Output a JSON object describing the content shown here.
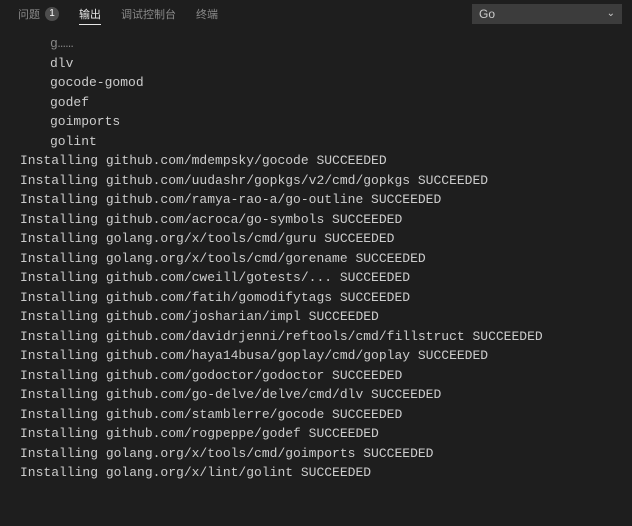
{
  "tabs": {
    "problems": {
      "label": "问题",
      "count": "1"
    },
    "output": {
      "label": "输出"
    },
    "debug": {
      "label": "调试控制台"
    },
    "terminal": {
      "label": "终端"
    }
  },
  "task_select": {
    "value": "Go"
  },
  "pending_obscured": "g……",
  "pending": [
    "dlv",
    "gocode-gomod",
    "godef",
    "goimports",
    "golint"
  ],
  "installs": [
    {
      "prefix": "Installing ",
      "pkg": "github.com/mdempsky/gocode",
      "status": " SUCCEEDED"
    },
    {
      "prefix": "Installing ",
      "pkg": "github.com/uudashr/gopkgs/v2/cmd/gopkgs",
      "status": " SUCCEEDED"
    },
    {
      "prefix": "Installing ",
      "pkg": "github.com/ramya-rao-a/go-outline",
      "status": " SUCCEEDED"
    },
    {
      "prefix": "Installing ",
      "pkg": "github.com/acroca/go-symbols",
      "status": " SUCCEEDED"
    },
    {
      "prefix": "Installing ",
      "pkg": "golang.org/x/tools/cmd/guru",
      "status": " SUCCEEDED"
    },
    {
      "prefix": "Installing ",
      "pkg": "golang.org/x/tools/cmd/gorename",
      "status": " SUCCEEDED"
    },
    {
      "prefix": "Installing ",
      "pkg": "github.com/cweill/gotests/...",
      "status": " SUCCEEDED"
    },
    {
      "prefix": "Installing ",
      "pkg": "github.com/fatih/gomodifytags",
      "status": " SUCCEEDED"
    },
    {
      "prefix": "Installing ",
      "pkg": "github.com/josharian/impl",
      "status": " SUCCEEDED"
    },
    {
      "prefix": "Installing ",
      "pkg": "github.com/davidrjenni/reftools/cmd/fillstruct",
      "status": " SUCCEEDED"
    },
    {
      "prefix": "Installing ",
      "pkg": "github.com/haya14busa/goplay/cmd/goplay",
      "status": " SUCCEEDED"
    },
    {
      "prefix": "Installing ",
      "pkg": "github.com/godoctor/godoctor",
      "status": " SUCCEEDED"
    },
    {
      "prefix": "Installing ",
      "pkg": "github.com/go-delve/delve/cmd/dlv",
      "status": " SUCCEEDED"
    },
    {
      "prefix": "Installing ",
      "pkg": "github.com/stamblerre/gocode",
      "status": " SUCCEEDED"
    },
    {
      "prefix": "Installing ",
      "pkg": "github.com/rogpeppe/godef",
      "status": " SUCCEEDED"
    },
    {
      "prefix": "Installing ",
      "pkg": "golang.org/x/tools/cmd/goimports",
      "status": " SUCCEEDED"
    },
    {
      "prefix": "Installing ",
      "pkg": "golang.org/x/lint/golint",
      "status": " SUCCEEDED"
    }
  ]
}
